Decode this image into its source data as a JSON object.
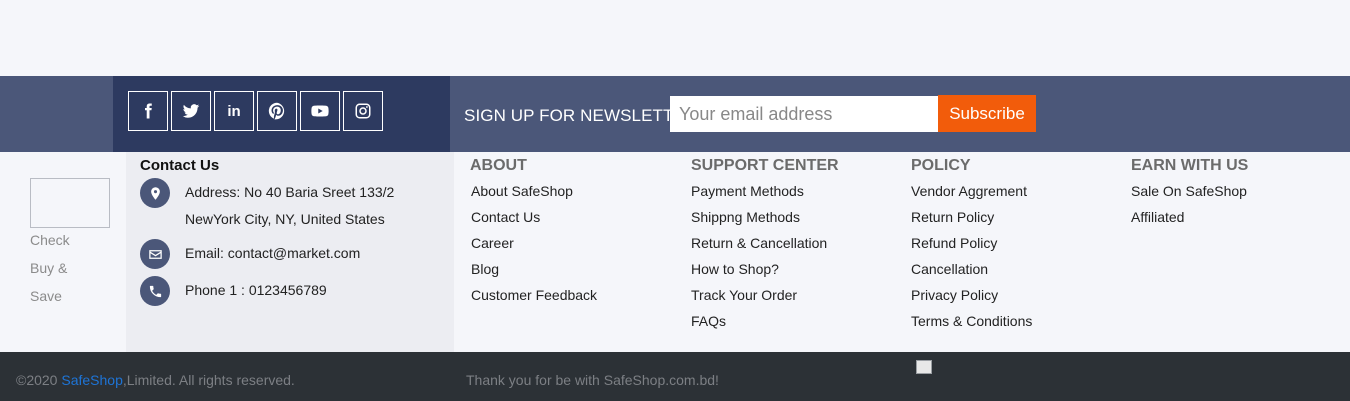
{
  "newsletter": {
    "label": "SIGN UP FOR NEWSLETTER",
    "email_placeholder": "Your email address",
    "subscribe_label": "Subscribe"
  },
  "social": [
    {
      "name": "facebook-icon"
    },
    {
      "name": "twitter-icon"
    },
    {
      "name": "linkedin-icon",
      "text": "in"
    },
    {
      "name": "pinterest-icon"
    },
    {
      "name": "youtube-icon"
    },
    {
      "name": "instagram-icon"
    }
  ],
  "brand": {
    "tagline_lines": [
      "Check",
      "Buy &",
      "Save"
    ]
  },
  "contact": {
    "title": "Contact Us",
    "address_line1": "Address: No 40 Baria Sreet 133/2",
    "address_line2": "NewYork City, NY, United States",
    "email": "Email: contact@market.com",
    "phone": "Phone 1 : 0123456789",
    "icons": [
      "location-pin-icon",
      "envelope-icon",
      "phone-icon"
    ]
  },
  "columns": [
    {
      "title": "ABOUT",
      "links": [
        "About SafeShop",
        "Contact Us",
        "Career",
        "Blog",
        "Customer Feedback"
      ]
    },
    {
      "title": "SUPPORT CENTER",
      "links": [
        "Payment Methods",
        "Shippng Methods",
        "Return & Cancellation",
        "How to Shop?",
        "Track Your Order",
        "FAQs"
      ]
    },
    {
      "title": "POLICY",
      "links": [
        "Vendor Aggrement",
        "Return Policy",
        "Refund Policy",
        "Cancellation",
        "Privacy Policy",
        "Terms & Conditions"
      ]
    },
    {
      "title": "EARN WITH US",
      "links": [
        "Sale On SafeShop",
        "Affiliated"
      ]
    }
  ],
  "bottom": {
    "copyright_prefix": "©2020 ",
    "brand_link": "SafeShop",
    "copyright_suffix": ",Limited. All rights reserved.",
    "thanks": "Thank you for be with SafeShop.com.bd!"
  },
  "colors": {
    "newsletter_band": "#4b5779",
    "social_panel": "#2d3a60",
    "subscribe_button": "#f25c0b",
    "bottom_bar": "#2c3136",
    "brand_link": "#1e74d6"
  }
}
